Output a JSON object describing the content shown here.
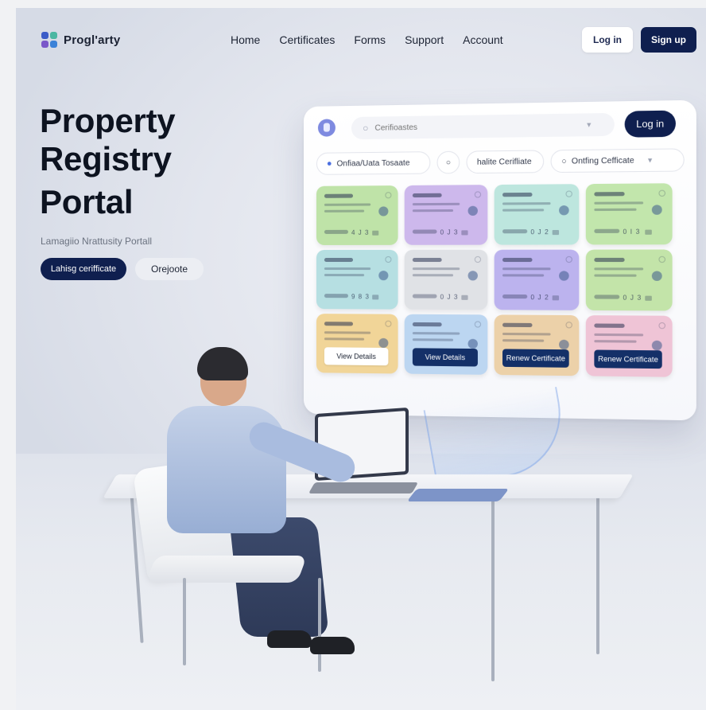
{
  "nav": {
    "brand": "Progl'arty",
    "links": [
      "Home",
      "Certificates",
      "Forms",
      "Support",
      "Account"
    ],
    "login": "Log in",
    "signup": "Sign up"
  },
  "hero": {
    "title_line1": "Property",
    "title_line2": "Registry",
    "title_line3": "Portal",
    "subtitle": "Lamagiio Nrattusity Portall",
    "primary_button": "Lahisg cerifficate",
    "secondary_button": "Orejoote"
  },
  "panel": {
    "search_placeholder": "Cerifioastes",
    "login": "Log in",
    "filter1": "Onfiaa/Uata Tosaate",
    "filter2": "halite Cerifliate",
    "filter3": "Ontfing Cefficate",
    "cards": [
      {
        "color": "#bfe3a8",
        "num": "4 J 3"
      },
      {
        "color": "#cdb8ec",
        "num": "0 J 3"
      },
      {
        "color": "#bde6de",
        "num": "0 J 2"
      },
      {
        "color": "#c2e6ac",
        "num": "0 I 3"
      },
      {
        "color": "#b6dfe2",
        "num": "9 8 3"
      },
      {
        "color": "#e0e2e6",
        "num": "0 J 3"
      },
      {
        "color": "#bcb3ee",
        "num": "0 J 2"
      },
      {
        "color": "#c3e4a9",
        "num": "0 J 3"
      },
      {
        "color": "#f1d598",
        "button": "View Details",
        "style": "light"
      },
      {
        "color": "#bcd6f1",
        "button": "View Details",
        "style": "dark"
      },
      {
        "color": "#ecd1a9",
        "button": "Renew Certificate",
        "style": "dark"
      },
      {
        "color": "#efc4d6",
        "button": "Renew Certificate",
        "style": "dark"
      }
    ]
  },
  "colors": {
    "navy": "#0f1f4f",
    "background": "#e4e7ef"
  },
  "icons": {
    "search": "search-icon",
    "pin": "location-pin-icon",
    "dropdown": "chevron-down-icon"
  }
}
